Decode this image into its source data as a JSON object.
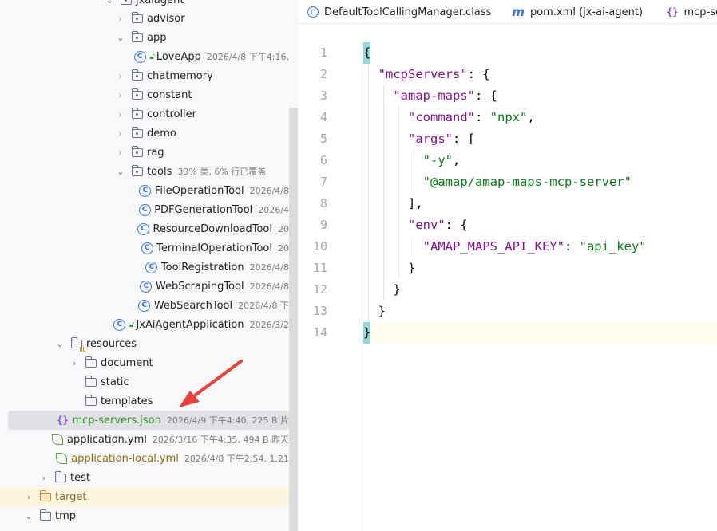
{
  "tree": {
    "rows": [
      {
        "label": "jxaiagent",
        "meta": "",
        "kind": "package"
      },
      {
        "label": "advisor",
        "meta": "",
        "kind": "package"
      },
      {
        "label": "app",
        "meta": "",
        "kind": "package"
      },
      {
        "label": "LoveApp",
        "meta": "2026/4/8 下午4:16,",
        "kind": "class"
      },
      {
        "label": "chatmemory",
        "meta": "",
        "kind": "package"
      },
      {
        "label": "constant",
        "meta": "",
        "kind": "package"
      },
      {
        "label": "controller",
        "meta": "",
        "kind": "package"
      },
      {
        "label": "demo",
        "meta": "",
        "kind": "package"
      },
      {
        "label": "rag",
        "meta": "",
        "kind": "package"
      },
      {
        "label": "tools",
        "meta": "33% 类, 6% 行已覆盖",
        "kind": "package"
      },
      {
        "label": "FileOperationTool",
        "meta": "2026/4/8",
        "kind": "class"
      },
      {
        "label": "PDFGenerationTool",
        "meta": "2026/4",
        "kind": "class"
      },
      {
        "label": "ResourceDownloadTool",
        "meta": "20",
        "kind": "class"
      },
      {
        "label": "TerminalOperationTool",
        "meta": "20",
        "kind": "class"
      },
      {
        "label": "ToolRegistration",
        "meta": "2026/4/8 ",
        "kind": "class"
      },
      {
        "label": "WebScrapingTool",
        "meta": "2026/4/8",
        "kind": "class"
      },
      {
        "label": "WebSearchTool",
        "meta": "2026/4/8 下",
        "kind": "class"
      },
      {
        "label": "JxAiAgentApplication",
        "meta": "2026/3/2",
        "kind": "app"
      },
      {
        "label": "resources",
        "meta": "",
        "kind": "resources"
      },
      {
        "label": "document",
        "meta": "",
        "kind": "folder"
      },
      {
        "label": "static",
        "meta": "",
        "kind": "folder"
      },
      {
        "label": "templates",
        "meta": "",
        "kind": "folder"
      },
      {
        "label": "mcp-servers.json",
        "meta": "2026/4/9 下午4:40, 225 B 片",
        "kind": "json"
      },
      {
        "label": "application.yml",
        "meta": "2026/3/16 下午4:35, 494 B 昨天",
        "kind": "yml"
      },
      {
        "label": "application-local.yml",
        "meta": "2026/4/8 下午2:54, 1.21",
        "kind": "yml"
      },
      {
        "label": "test",
        "meta": "",
        "kind": "folder"
      },
      {
        "label": "target",
        "meta": "",
        "kind": "folder-orange"
      },
      {
        "label": "tmp",
        "meta": "",
        "kind": "folder"
      }
    ]
  },
  "editor": {
    "tabs": [
      {
        "label": "DefaultToolCallingManager.class",
        "icon": "class-file-icon"
      },
      {
        "label": "pom.xml (jx-ai-agent)",
        "icon": "maven-icon"
      },
      {
        "label": "mcp-serv",
        "icon": "json-icon"
      }
    ],
    "line_numbers": [
      "1",
      "2",
      "3",
      "4",
      "5",
      "6",
      "7",
      "8",
      "9",
      "10",
      "11",
      "12",
      "13",
      "14"
    ],
    "code": {
      "l1": "{",
      "l2_key": "\"mcpServers\"",
      "l3_key": "\"amap-maps\"",
      "l4_key": "\"command\"",
      "l4_val": "\"npx\"",
      "l5_key": "\"args\"",
      "l6_val": "\"-y\"",
      "l7_val": "\"@amap/amap-maps-mcp-server\"",
      "l8": "],",
      "l9_key": "\"env\"",
      "l10_key": "\"AMAP_MAPS_API_KEY\"",
      "l10_val": "\"api_key\"",
      "l11": "}",
      "l12": "}",
      "l13": "}",
      "l14": "}"
    }
  },
  "colors": {
    "json_key": "#871094",
    "json_string": "#067d17",
    "arrow": "#e8423a",
    "selection": "#dfe1e5"
  }
}
